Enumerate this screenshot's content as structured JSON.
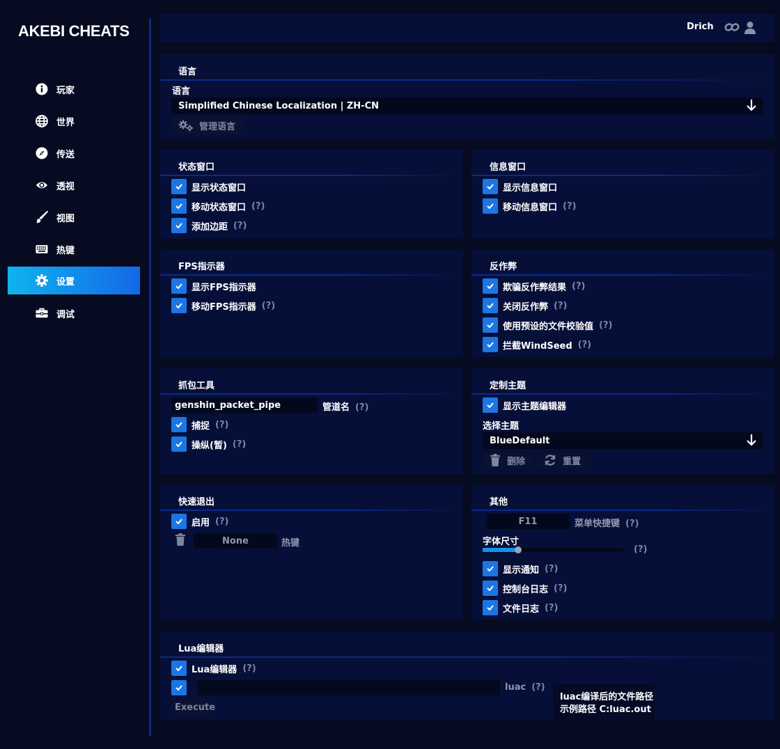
{
  "app": {
    "title": "AKEBI CHEATS",
    "user": "Drich",
    "accent_color": "#1b76e4",
    "panel_color": "#060f38"
  },
  "sidebar": {
    "items": [
      {
        "label": "玩家",
        "icon": "info-icon"
      },
      {
        "label": "世界",
        "icon": "globe-icon"
      },
      {
        "label": "传送",
        "icon": "compass-icon"
      },
      {
        "label": "透视",
        "icon": "eye-icon"
      },
      {
        "label": "视图",
        "icon": "brush-icon"
      },
      {
        "label": "热键",
        "icon": "keyboard-icon"
      },
      {
        "label": "设置",
        "icon": "gear-icon",
        "active": true
      },
      {
        "label": "调试",
        "icon": "toolbox-icon"
      }
    ]
  },
  "language": {
    "title": "语言",
    "label": "语言",
    "selected": "Simplified Chinese Localization | ZH-CN",
    "manage_label": "管理语言"
  },
  "status_window": {
    "title": "状态窗口",
    "items": [
      "显示状态窗口",
      "移动状态窗口",
      "添加边距"
    ],
    "help": "(?)"
  },
  "info_window": {
    "title": "信息窗口",
    "items": [
      "显示信息窗口",
      "移动信息窗口"
    ],
    "help": "(?)"
  },
  "fps": {
    "title": "FPS指示器",
    "items": [
      "显示FPS指示器",
      "移动FPS指示器"
    ],
    "help": "(?)"
  },
  "anticheat": {
    "title": "反作弊",
    "items": [
      "欺骗反作弊结果",
      "关闭反作弊",
      "使用预设的文件校验值",
      "拦截WindSeed"
    ],
    "help": "(?)"
  },
  "packet": {
    "title": "抓包工具",
    "pipe_value": "genshin_packet_pipe",
    "pipe_label": "管道名",
    "items": [
      "捕捉",
      "操纵(暂)"
    ],
    "help": "(?)"
  },
  "theme": {
    "title": "定制主题",
    "show_editor": "显示主题编辑器",
    "select_label": "选择主题",
    "selected": "BlueDefault",
    "delete_label": "删除",
    "reset_label": "重置"
  },
  "quick_exit": {
    "title": "快速退出",
    "enable_label": "启用",
    "hotkey_value": "None",
    "hotkey_label": "热键",
    "help": "(?)"
  },
  "other": {
    "title": "其他",
    "menu_key_value": "F11",
    "menu_key_label": "菜单快捷键",
    "font_size_label": "字体尺寸",
    "font_size_fraction": 0.24,
    "items": [
      "显示通知",
      "控制台日志",
      "文件日志"
    ],
    "help": "(?)"
  },
  "lua": {
    "title": "Lua编辑器",
    "editor_label": "Lua编辑器",
    "luac_label": "luac",
    "execute_label": "Execute",
    "help": "(?)",
    "tooltip_line1": "luac编译后的文件路径",
    "tooltip_line2": "示例路径 C:luac.out"
  }
}
